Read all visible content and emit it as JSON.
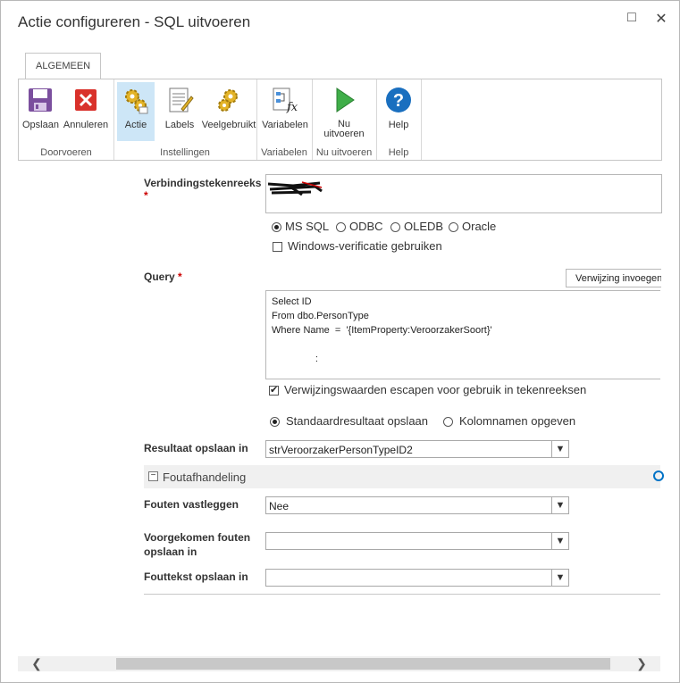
{
  "window": {
    "title": "Actie configureren - SQL uitvoeren",
    "maximize_glyph": "□",
    "close_glyph": "✕"
  },
  "ribbon": {
    "tab_label": "ALGEMEEN",
    "groups": [
      {
        "label": "Doorvoeren",
        "buttons": [
          {
            "label": "Opslaan",
            "icon": "save-icon"
          },
          {
            "label": "Annuleren",
            "icon": "cancel-icon"
          }
        ]
      },
      {
        "label": "Instellingen",
        "buttons": [
          {
            "label": "Actie",
            "icon": "gears-icon"
          },
          {
            "label": "Labels",
            "icon": "labels-icon"
          },
          {
            "label": "Veelgebruikt",
            "icon": "gear-icon"
          }
        ]
      },
      {
        "label": "Variabelen",
        "buttons": [
          {
            "label": "Variabelen",
            "icon": "variables-icon"
          }
        ]
      },
      {
        "label": "Nu uitvoeren",
        "buttons": [
          {
            "label_line1": "Nu",
            "label_line2": "uitvoeren",
            "icon": "run-icon"
          }
        ]
      },
      {
        "label": "Help",
        "buttons": [
          {
            "label": "Help",
            "icon": "help-icon"
          }
        ]
      }
    ]
  },
  "form": {
    "connection": {
      "label": "Verbindingstekenreeks",
      "required_mark": "*"
    },
    "db_options": {
      "selected": "MS SQL",
      "items": [
        "MS SQL",
        "ODBC",
        "OLEDB",
        "Oracle"
      ]
    },
    "windows_auth": {
      "label": "Windows-verificatie gebruiken",
      "checked": false
    },
    "query": {
      "label": "Query",
      "required_mark": "*",
      "insert_ref_button": "Verwijzing invoegen",
      "lines": [
        "Select ID",
        "From dbo.PersonType",
        "Where Name  =  '{ItemProperty:VeroorzakerSoort}'",
        "",
        "                :"
      ]
    },
    "escape_refs": {
      "label": "Verwijzingswaarden escapen voor gebruik in tekenreeksen",
      "checked": true
    },
    "result_mode": {
      "option1": "Standaardresultaat opslaan",
      "option2": "Kolomnamen opgeven",
      "selected": "Standaardresultaat opslaan"
    },
    "result_store": {
      "label": "Resultaat opslaan in",
      "value": "strVeroorzakerPersonTypeID2"
    },
    "error_section": {
      "title": "Foutafhandeling",
      "collapse_glyph": "−"
    },
    "log_errors": {
      "label": "Fouten vastleggen",
      "value": "Nee"
    },
    "errors_store": {
      "label_line1": "Voorgekomen fouten",
      "label_line2": "opslaan in",
      "value": ""
    },
    "error_text_store": {
      "label": "Fouttekst opslaan in",
      "value": ""
    }
  },
  "colors": {
    "accent": "#0072c6",
    "active_button_bg": "#cde6f7",
    "required": "#cc0000"
  }
}
